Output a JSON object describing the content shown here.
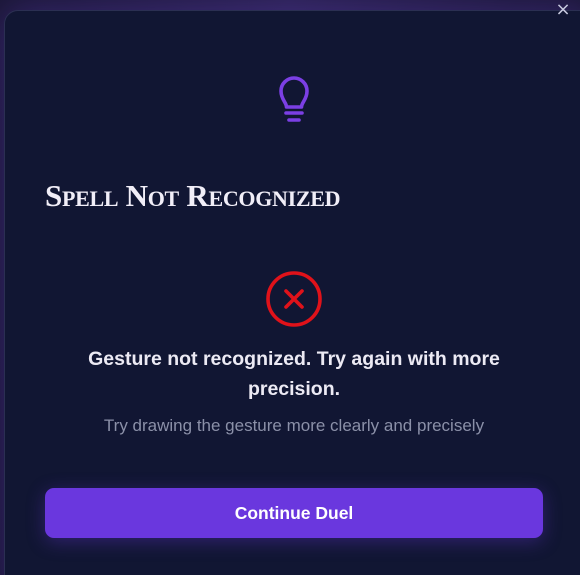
{
  "dialog": {
    "close_symbol": "×",
    "icon": "lightbulb-icon",
    "title": "Spell Not Recognized",
    "status_icon": "x-circle-icon",
    "message": "Gesture not recognized. Try again with more precision.",
    "hint": "Try drawing the gesture more clearly and precisely",
    "continue_label": "Continue Duel"
  },
  "colors": {
    "accent": "#6a37de",
    "icon_purple": "#7b3fe4",
    "error_red": "#e0121a",
    "background": "#111633",
    "hint_text": "#8b90a8"
  }
}
